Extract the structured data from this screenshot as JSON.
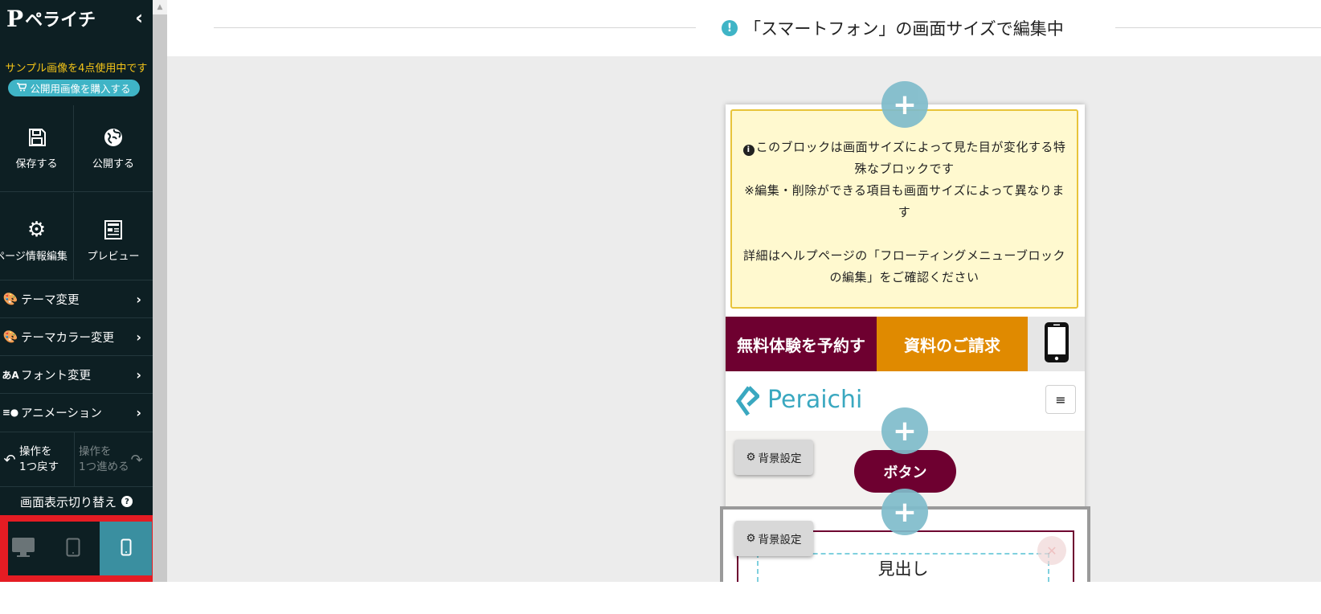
{
  "sidebar": {
    "logo_text": "ペライチ",
    "logo_mark": "P",
    "collapse_icon": "chevron-left-icon",
    "notice": "サンプル画像を4点使用中です",
    "buy_button": "公開用画像を購入する",
    "save_label": "保存する",
    "publish_label": "公開する",
    "page_info_label": "ページ情報編集",
    "preview_label": "プレビュー",
    "menu": [
      {
        "label": "テーマ変更",
        "icon": "palette-icon"
      },
      {
        "label": "テーマカラー変更",
        "icon": "palette-icon"
      },
      {
        "label": "フォント変更",
        "icon": "font-icon"
      },
      {
        "label": "アニメーション",
        "icon": "animation-icon"
      }
    ],
    "undo_line1": "操作を",
    "undo_line2": "1つ戻す",
    "redo_line1": "操作を",
    "redo_line2": "1つ進める",
    "display_switch_label": "画面表示切り替え",
    "devices": [
      {
        "name": "desktop",
        "active": false
      },
      {
        "name": "tablet",
        "active": false
      },
      {
        "name": "smartphone",
        "active": true
      }
    ]
  },
  "header": {
    "editing_label": "「スマートフォン」の画面サイズで編集中"
  },
  "canvas": {
    "warning": {
      "line1": "このブロックは画面サイズによって見た目が変化する特殊なブロックです",
      "line2": "※編集・削除ができる項目も画面サイズによって異なります",
      "line3": "詳細はヘルプページの「フローティングメニューブロックの編集」をご確認ください"
    },
    "cta_reserve": "無料体験を予約す",
    "cta_docs": "資料のご請求",
    "brand_name": "Peraichi",
    "bg_settings_label": "背景設定",
    "button_label": "ボタン",
    "heading_label": "見出し"
  },
  "colors": {
    "sidebar_bg": "#0d1f23",
    "accent": "#3fb4c6",
    "notice": "#f5c518",
    "cta_reserve_bg": "#6e0030",
    "cta_docs_bg": "#e08a00",
    "highlight_frame": "#e51c23"
  }
}
